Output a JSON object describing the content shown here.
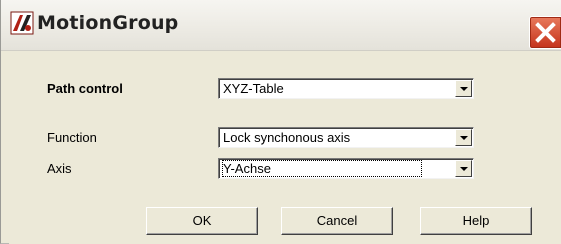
{
  "window": {
    "title": "MotionGroup",
    "icon": "motion-group-app-icon",
    "close_icon": "close-icon"
  },
  "form": {
    "path_control": {
      "label": "Path control",
      "value": "XYZ-Table"
    },
    "function": {
      "label": "Function",
      "value": "Lock synchonous axis"
    },
    "axis": {
      "label": "Axis",
      "value": "Y-Achse"
    }
  },
  "buttons": {
    "ok": "OK",
    "cancel": "Cancel",
    "help": "Help"
  },
  "colors": {
    "dialog_face": "#ece9d8",
    "close_red": "#c4321a"
  }
}
